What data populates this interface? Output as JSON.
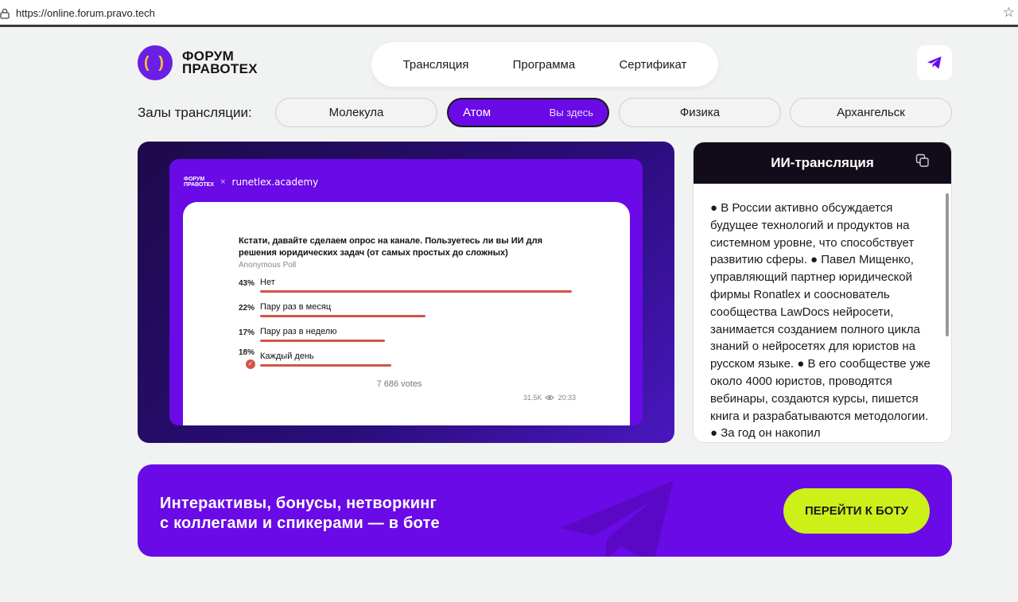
{
  "browser": {
    "url": "https://online.forum.pravo.tech"
  },
  "logo": {
    "mark": "( )",
    "line1": "ФОРУМ",
    "line2": "ПРАВОТЕХ"
  },
  "nav": {
    "items": [
      "Трансляция",
      "Программа",
      "Сертификат"
    ]
  },
  "halls": {
    "label": "Залы трансляции:",
    "items": [
      {
        "name": "Молекула",
        "active": false
      },
      {
        "name": "Атом",
        "active": true,
        "here": "Вы здесь"
      },
      {
        "name": "Физика",
        "active": false
      },
      {
        "name": "Архангельск",
        "active": false
      }
    ]
  },
  "video": {
    "slide_logo_line1": "ФОРУМ",
    "slide_logo_line2": "ПРАВОТЕХ",
    "slide_x": "×",
    "slide_partner": "runetlex.academy",
    "poll": {
      "question": "Кстати, давайте сделаем опрос на канале. Пользуетесь ли вы ИИ для решения юридических задач (от самых простых до сложных)",
      "type": "Anonymous Poll",
      "options": [
        {
          "pct": "43%",
          "label": "Нет",
          "share": 1.0
        },
        {
          "pct": "22%",
          "label": "Пару раз в месяц",
          "share": 0.53
        },
        {
          "pct": "17%",
          "label": "Пару раз в неделю",
          "share": 0.4
        },
        {
          "pct": "18%",
          "label": "Каждый день",
          "share": 0.42,
          "checked": true
        }
      ],
      "votes": "7 686 votes",
      "views": "31.5K",
      "time": "20:33"
    }
  },
  "ai": {
    "title": "ИИ-трансляция",
    "text": "● В России активно обсуждается будущее технологий и продуктов на системном уровне, что способствует развитию сферы. ● Павел Мищенко, управляющий партнер юридической фирмы Ronatlex и сооснователь сообщества LawDocs нейросети, занимается созданием полного цикла знаний о нейросетях для юристов на русском языке. ● В его сообществе уже около 4000 юристов, проводятся вебинары, создаются курсы, пишется книга и разрабатываются методологии. ● За год он накопил"
  },
  "banner": {
    "line1": "Интерактивы, бонусы, нетворкинг",
    "line2": "с коллегами и спикерами — в боте",
    "button": "ПЕРЕЙТИ К БОТУ"
  },
  "colors": {
    "accent": "#6a0ae6",
    "button": "#cdf019",
    "poll_bar": "#d0544a"
  }
}
